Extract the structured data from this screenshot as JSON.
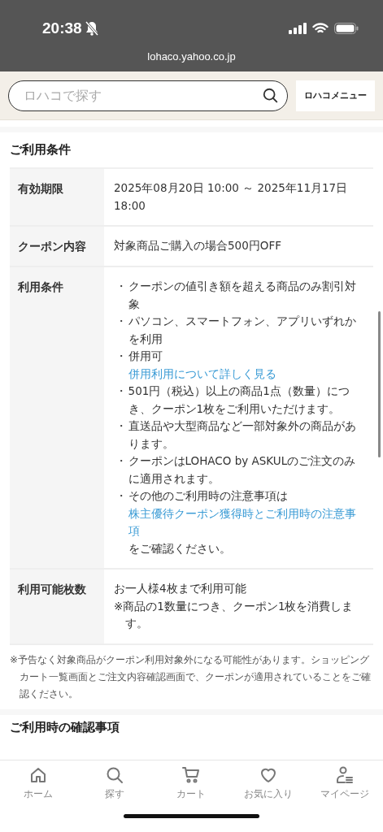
{
  "status_bar": {
    "time": "20:38",
    "url": "lohaco.yahoo.co.jp"
  },
  "header": {
    "search": {
      "placeholder": "ロハコで探す"
    },
    "menu_button": "ロハコメニュー"
  },
  "section": {
    "title": "ご利用条件",
    "rows": [
      {
        "label": "有効期限",
        "kind": "text",
        "lines": [
          "2025年08月20日 10:00 ～ 2025年11月17日 18:00"
        ]
      },
      {
        "label": "クーポン内容",
        "kind": "text",
        "lines": [
          "対象商品ご購入の場合500円OFF"
        ]
      },
      {
        "label": "利用条件",
        "kind": "bullets",
        "items": [
          {
            "bullet": "・",
            "text": "クーポンの値引き額を超える商品のみ割引対象"
          },
          {
            "bullet": "・",
            "text": "パソコン、スマートフォン、アプリいずれかを利用"
          },
          {
            "bullet": "・",
            "text": "併用可",
            "link_below": "併用利用について詳しく見る"
          },
          {
            "bullet": "・",
            "text": "501円（税込）以上の商品1点（数量）につき、クーポン1枚をご利用いただけます。"
          },
          {
            "bullet": "・",
            "text": "直送品や大型商品など一部対象外の商品があります。"
          },
          {
            "bullet": "・",
            "text": "クーポンはLOHACO by ASKULのご注文のみに適用されます。"
          },
          {
            "bullet": "・",
            "text": "その他のご利用時の注意事項は",
            "link": "株主優待クーポン獲得時とご利用時の注意事項",
            "after": "をご確認ください。"
          }
        ]
      },
      {
        "label": "利用可能枚数",
        "kind": "text",
        "lines": [
          "お一人様4枚まで利用可能",
          "※商品の1数量につき、クーポン1枚を消費します。"
        ]
      }
    ],
    "note": "※予告なく対象商品がクーポン利用対象外になる可能性があります。ショッピングカート一覧画面とご注文内容確認画面で、クーポンが適用されていることをご確認ください。"
  },
  "next_section": {
    "title": "ご利用時の確認事項"
  },
  "bottom_nav": [
    {
      "label": "ホーム"
    },
    {
      "label": "探す"
    },
    {
      "label": "カート"
    },
    {
      "label": "お気に入り"
    },
    {
      "label": "マイページ"
    }
  ]
}
